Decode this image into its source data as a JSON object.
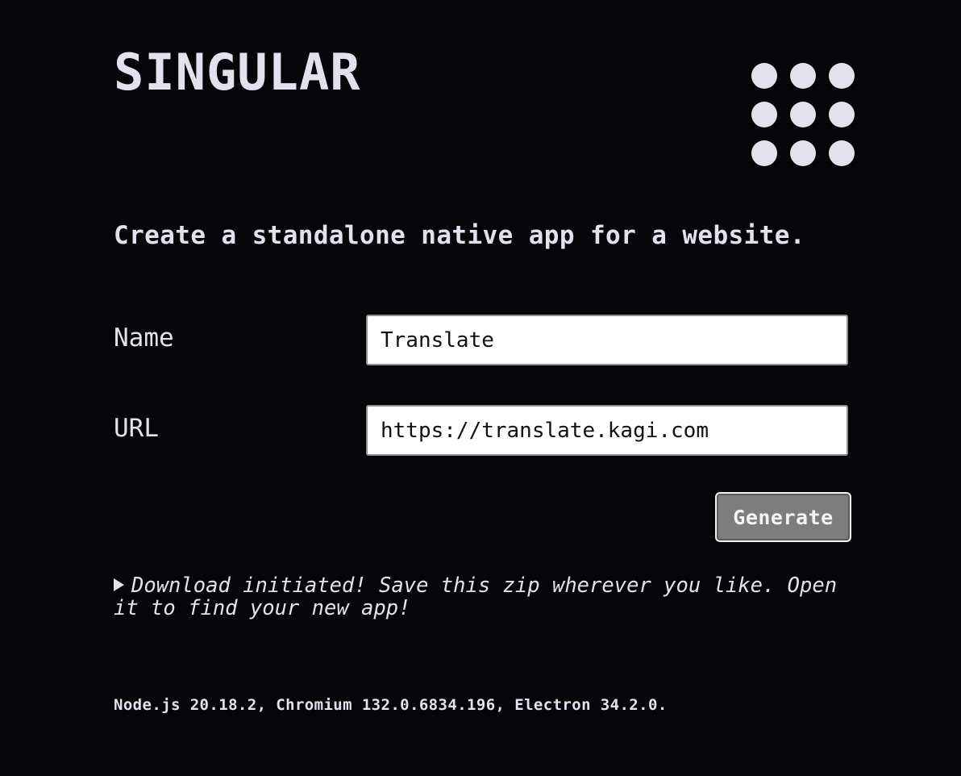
{
  "app": {
    "title": "SINGULAR",
    "logo_icon": "nine-dot-grid-icon"
  },
  "intro": {
    "tagline": "Create a standalone native app for a website."
  },
  "form": {
    "name_label": "Name",
    "name_value": "Translate",
    "url_label": "URL",
    "url_value": "https://translate.kagi.com",
    "generate_label": "Generate"
  },
  "status": {
    "icon": "disclosure-triangle-icon",
    "message": "Download initiated! Save this zip wherever you like. Open it to find your new app!"
  },
  "footer": {
    "versions": "Node.js 20.18.2, Chromium 132.0.6834.196, Electron 34.2.0."
  },
  "colors": {
    "background": "#060608",
    "text": "#e3e1ee",
    "button": "#7d7d7d",
    "input_background": "#ffffff"
  }
}
